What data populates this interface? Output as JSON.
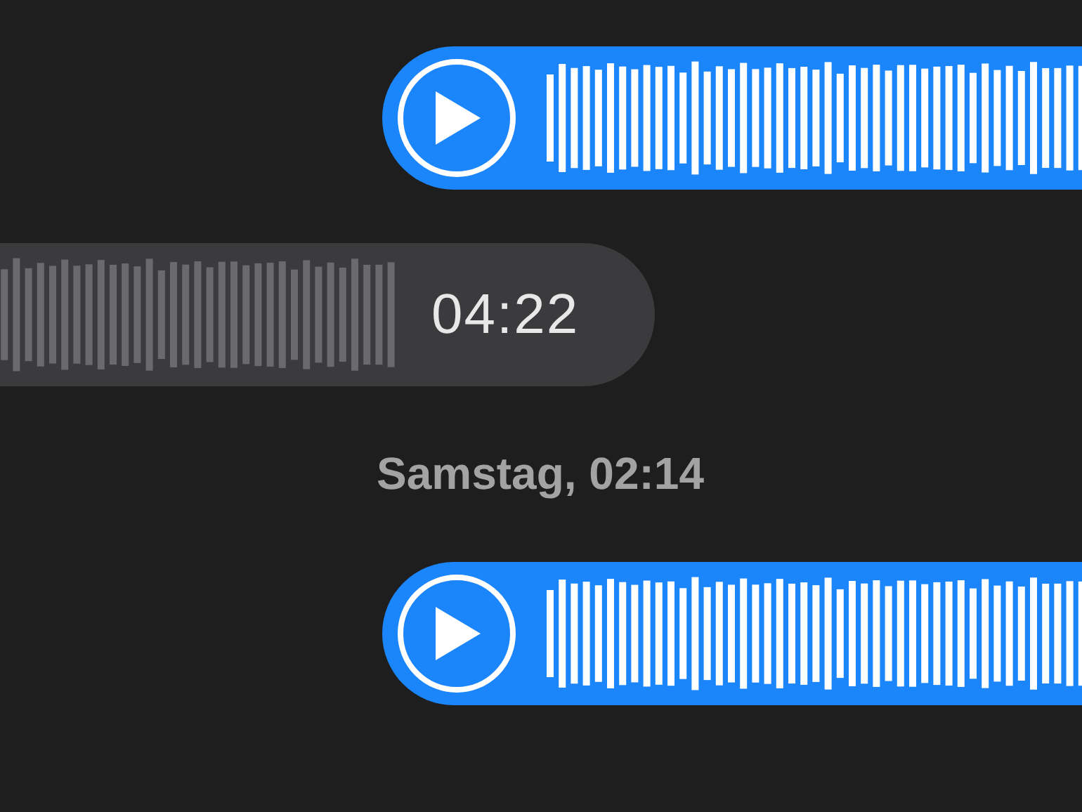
{
  "conversation": [
    {
      "kind": "audio",
      "sent": true
    },
    {
      "kind": "audio",
      "sent": false,
      "duration": "04:22"
    },
    {
      "kind": "timestamp",
      "text": "Samstag, 02:14"
    },
    {
      "kind": "audio",
      "sent": true
    }
  ]
}
